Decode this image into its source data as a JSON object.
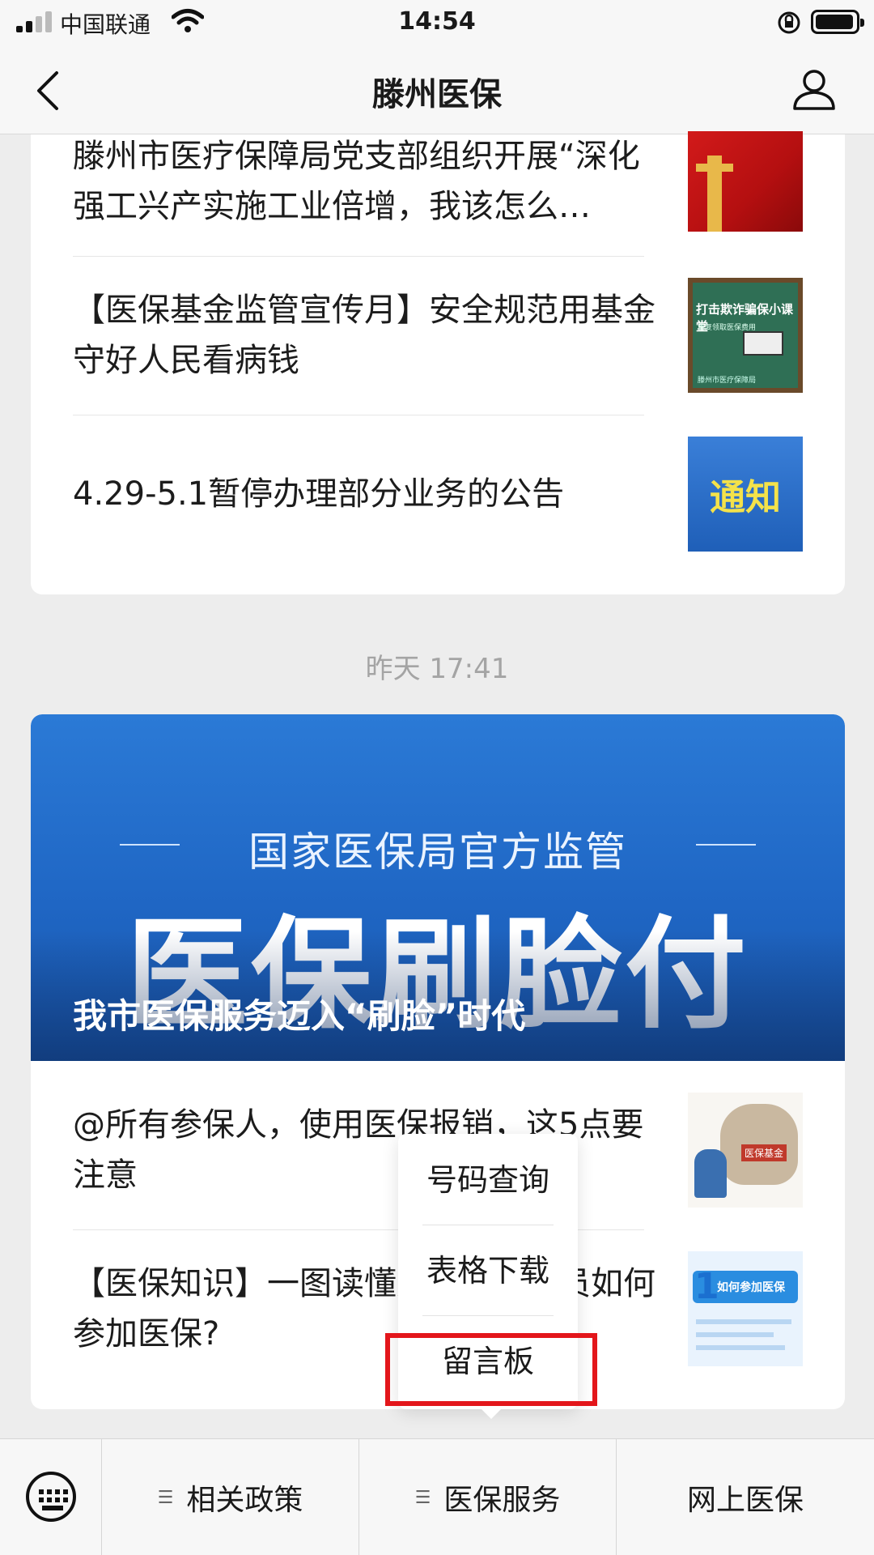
{
  "status_bar": {
    "carrier": "中国联通",
    "time": "14:54",
    "icons": [
      "signal-icon",
      "wifi-icon",
      "rotation-lock-icon",
      "battery-icon"
    ]
  },
  "navbar": {
    "title": "滕州医保",
    "icons": [
      "back-icon",
      "profile-icon"
    ]
  },
  "articles_top": [
    {
      "title": "滕州市医疗保障局党支部组织开展“深化强工兴产实施工业倍增，我该怎么…",
      "thumb": "flag-image"
    },
    {
      "title": "【医保基金监管宣传月】安全规范用基金 守好人民看病钱",
      "thumb": "classroom-image",
      "thumb_text": "打击欺诈骗保小课堂",
      "thumb_subtext": "重复领取医保费用",
      "thumb_footer": "滕州市医疗保障局"
    },
    {
      "title": "4.29-5.1暂停办理部分业务的公告",
      "thumb": "notice-image",
      "thumb_text": "通知"
    }
  ],
  "timestamp": "昨天 17:41",
  "banner": {
    "subtitle": "国家医保局官方监管",
    "headline": "医保刷脸付",
    "caption": "我市医保服务迈入“刷脸”时代"
  },
  "articles_bottom": [
    {
      "title": "@所有参保人，使用医保报销，这5点要注意",
      "thumb": "bag-image",
      "thumb_text": "医保基金"
    },
    {
      "title": "【医保知识】一图读懂灵活就业人员如何参加医保?",
      "thumb": "infographic-image",
      "thumb_text": "如何参加医保",
      "thumb_num": "1"
    }
  ],
  "popup_menu": {
    "items": [
      "号码查询",
      "表格下载",
      "留言板"
    ],
    "highlighted": "留言板",
    "highlight_color": "#e3161b"
  },
  "bottom_menu": {
    "items": [
      "相关政策",
      "医保服务",
      "网上医保"
    ],
    "keyboard_icon": "keyboard-icon"
  }
}
